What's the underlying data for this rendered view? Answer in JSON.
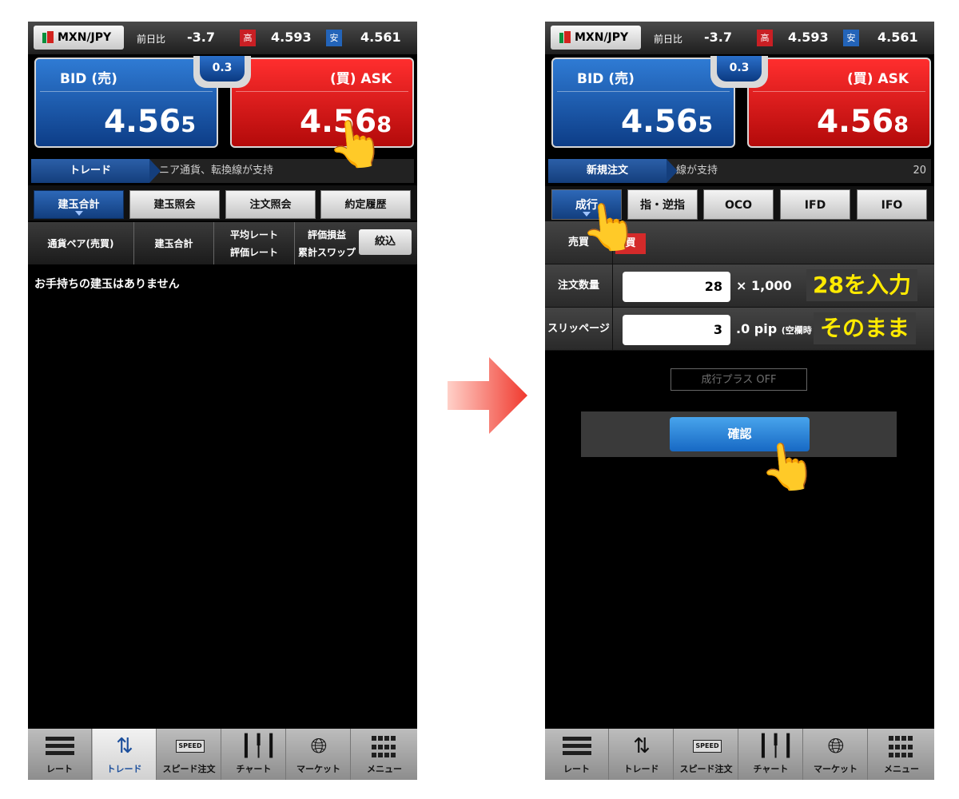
{
  "colors": {
    "bid": "#1a4fa3",
    "ask": "#d11a1a",
    "accent_tab": "#1c4f9c",
    "annotation": "#ffea00",
    "arrow": "#f04a3f"
  },
  "common": {
    "pair": "MXN/JPY",
    "change_label": "前日比",
    "change_value": "-3.7",
    "high_label": "高",
    "high_value": "4.593",
    "low_label": "安",
    "low_value": "4.561",
    "bid_label": "BID (売)",
    "bid_main": "4.56",
    "bid_pip": "5",
    "ask_label": "(買) ASK",
    "ask_main": "4.56",
    "ask_pip": "8",
    "spread": "0.3"
  },
  "left": {
    "ticker_tab": "トレード",
    "ticker_text": "ニア通貨、転換線が支持",
    "tabs": [
      "建玉合計",
      "建玉照会",
      "注文照会",
      "約定履歴"
    ],
    "columns": {
      "pair": "通貨ペア(売買)",
      "total": "建玉合計",
      "rate_avg": "平均レート",
      "rate_eval": "評価レート",
      "pl": "評価損益",
      "swap": "累計スワップ"
    },
    "filter_button": "絞込",
    "empty_message": "お手持ちの建玉はありません"
  },
  "right": {
    "ticker_tab": "新規注文",
    "ticker_text": "線が支持",
    "ticker_num": "20",
    "order_tabs": [
      "成行",
      "指・逆指",
      "OCO",
      "IFD",
      "IFO"
    ],
    "side_label": "売買",
    "side_value": "買",
    "qty_label": "注文数量",
    "qty_value": "28",
    "qty_unit": "× 1,000",
    "qty_annotation": "28を入力",
    "slip_label": "スリッページ",
    "slip_value": "3",
    "slip_unit": ".0 pip",
    "slip_note": "(空欄時",
    "slip_annotation": "そのまま",
    "market_plus": "成行プラス OFF",
    "confirm_button": "確認"
  },
  "nav": [
    "レート",
    "トレード",
    "スピード注文",
    "チャート",
    "マーケット",
    "メニュー"
  ],
  "icons": {
    "pointer": "pointing-finger-icon",
    "speed": "SPEED"
  }
}
